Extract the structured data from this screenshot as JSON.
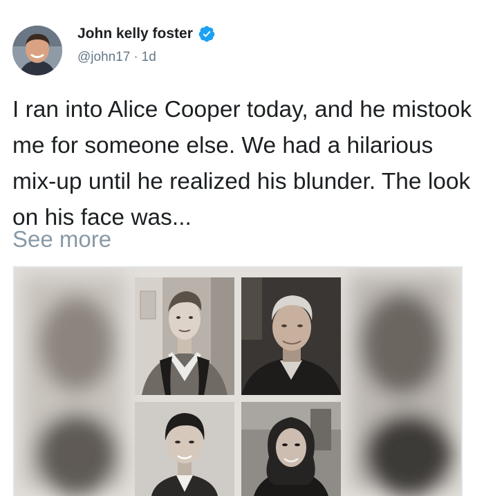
{
  "tweet": {
    "display_name": "John kelly foster",
    "handle": "@john17",
    "separator": "·",
    "age": "1d",
    "text": "I ran into Alice Cooper today, and he mistook me for someone else. We had a hilarious mix-up until he realized his blunder. The look on his face was...",
    "see_more": "See more"
  },
  "icons": {
    "verified": "verified-badge-icon"
  },
  "colors": {
    "accent": "#1da1f2",
    "secondary_text": "#657786",
    "see_more": "#8899a6"
  }
}
